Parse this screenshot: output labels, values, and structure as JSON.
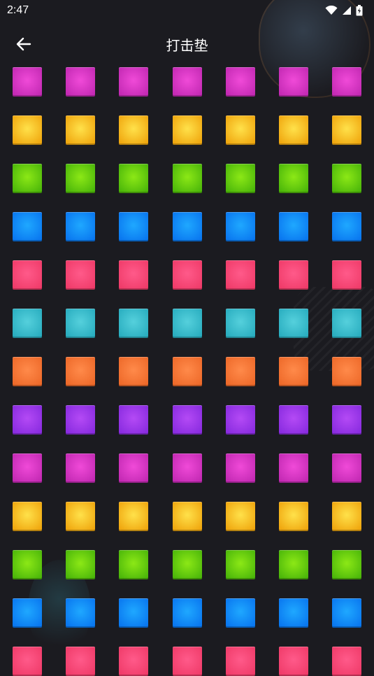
{
  "status_bar": {
    "time": "2:47",
    "icons": [
      "wifi-icon",
      "signal-icon",
      "battery-icon"
    ]
  },
  "app_bar": {
    "title": "打击垫",
    "back_icon": "arrow-left-icon"
  },
  "pad_grid": {
    "columns": 7,
    "rows": [
      {
        "color": "magenta",
        "center": "#f04ad8",
        "edge": "#c42ab4"
      },
      {
        "color": "yellow",
        "center": "#ffe14a",
        "edge": "#f0a810"
      },
      {
        "color": "green",
        "center": "#8ce816",
        "edge": "#4db80a"
      },
      {
        "color": "blue",
        "center": "#1fa8ff",
        "edge": "#0a78f0"
      },
      {
        "color": "pink",
        "center": "#ff5a8a",
        "edge": "#f03c6a"
      },
      {
        "color": "cyan",
        "center": "#55d0dc",
        "edge": "#2aaec0"
      },
      {
        "color": "orange",
        "center": "#ff8a4a",
        "edge": "#ee6a2a"
      },
      {
        "color": "purple",
        "center": "#b44af5",
        "edge": "#8a2ce0"
      },
      {
        "color": "magenta",
        "center": "#f04ad8",
        "edge": "#c42ab4"
      },
      {
        "color": "yellow",
        "center": "#ffe14a",
        "edge": "#f0a810"
      },
      {
        "color": "green",
        "center": "#8ce816",
        "edge": "#4db80a"
      },
      {
        "color": "blue",
        "center": "#1fa8ff",
        "edge": "#0a78f0"
      },
      {
        "color": "pink",
        "center": "#ff5a8a",
        "edge": "#f03c6a"
      }
    ]
  }
}
